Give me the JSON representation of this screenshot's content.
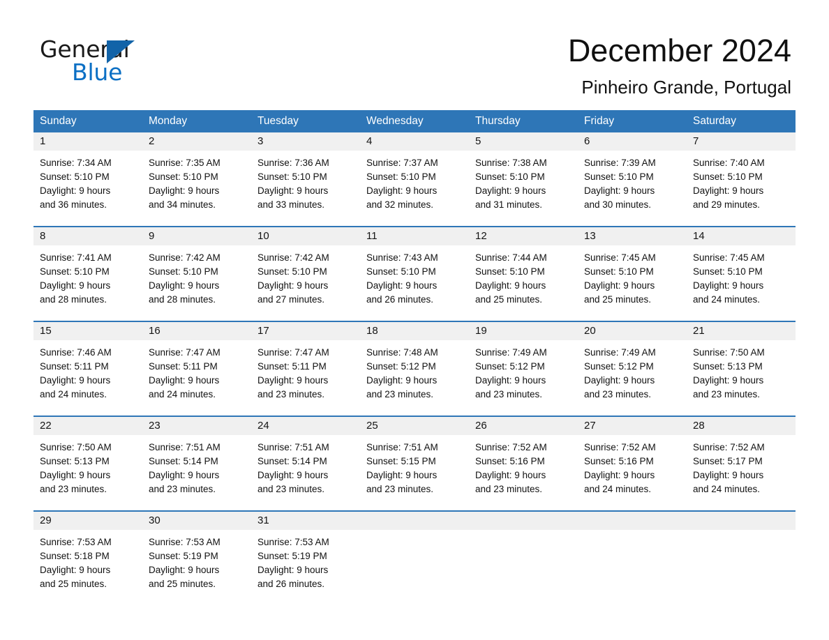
{
  "logo": {
    "word_one": "General",
    "word_two": "Blue",
    "accent_color": "#1263a8",
    "blue_text_color": "#0b6fc4"
  },
  "header": {
    "month_title": "December 2024",
    "location": "Pinheiro Grande, Portugal"
  },
  "theme": {
    "header_blue": "#2e76b7",
    "day_band_gray": "#f0f0f0",
    "text_black": "#111111"
  },
  "weekdays": [
    "Sunday",
    "Monday",
    "Tuesday",
    "Wednesday",
    "Thursday",
    "Friday",
    "Saturday"
  ],
  "weeks": [
    [
      {
        "day": "1",
        "sunrise": "Sunrise: 7:34 AM",
        "sunset": "Sunset: 5:10 PM",
        "daylight_line1": "Daylight: 9 hours",
        "daylight_line2": "and 36 minutes."
      },
      {
        "day": "2",
        "sunrise": "Sunrise: 7:35 AM",
        "sunset": "Sunset: 5:10 PM",
        "daylight_line1": "Daylight: 9 hours",
        "daylight_line2": "and 34 minutes."
      },
      {
        "day": "3",
        "sunrise": "Sunrise: 7:36 AM",
        "sunset": "Sunset: 5:10 PM",
        "daylight_line1": "Daylight: 9 hours",
        "daylight_line2": "and 33 minutes."
      },
      {
        "day": "4",
        "sunrise": "Sunrise: 7:37 AM",
        "sunset": "Sunset: 5:10 PM",
        "daylight_line1": "Daylight: 9 hours",
        "daylight_line2": "and 32 minutes."
      },
      {
        "day": "5",
        "sunrise": "Sunrise: 7:38 AM",
        "sunset": "Sunset: 5:10 PM",
        "daylight_line1": "Daylight: 9 hours",
        "daylight_line2": "and 31 minutes."
      },
      {
        "day": "6",
        "sunrise": "Sunrise: 7:39 AM",
        "sunset": "Sunset: 5:10 PM",
        "daylight_line1": "Daylight: 9 hours",
        "daylight_line2": "and 30 minutes."
      },
      {
        "day": "7",
        "sunrise": "Sunrise: 7:40 AM",
        "sunset": "Sunset: 5:10 PM",
        "daylight_line1": "Daylight: 9 hours",
        "daylight_line2": "and 29 minutes."
      }
    ],
    [
      {
        "day": "8",
        "sunrise": "Sunrise: 7:41 AM",
        "sunset": "Sunset: 5:10 PM",
        "daylight_line1": "Daylight: 9 hours",
        "daylight_line2": "and 28 minutes."
      },
      {
        "day": "9",
        "sunrise": "Sunrise: 7:42 AM",
        "sunset": "Sunset: 5:10 PM",
        "daylight_line1": "Daylight: 9 hours",
        "daylight_line2": "and 28 minutes."
      },
      {
        "day": "10",
        "sunrise": "Sunrise: 7:42 AM",
        "sunset": "Sunset: 5:10 PM",
        "daylight_line1": "Daylight: 9 hours",
        "daylight_line2": "and 27 minutes."
      },
      {
        "day": "11",
        "sunrise": "Sunrise: 7:43 AM",
        "sunset": "Sunset: 5:10 PM",
        "daylight_line1": "Daylight: 9 hours",
        "daylight_line2": "and 26 minutes."
      },
      {
        "day": "12",
        "sunrise": "Sunrise: 7:44 AM",
        "sunset": "Sunset: 5:10 PM",
        "daylight_line1": "Daylight: 9 hours",
        "daylight_line2": "and 25 minutes."
      },
      {
        "day": "13",
        "sunrise": "Sunrise: 7:45 AM",
        "sunset": "Sunset: 5:10 PM",
        "daylight_line1": "Daylight: 9 hours",
        "daylight_line2": "and 25 minutes."
      },
      {
        "day": "14",
        "sunrise": "Sunrise: 7:45 AM",
        "sunset": "Sunset: 5:10 PM",
        "daylight_line1": "Daylight: 9 hours",
        "daylight_line2": "and 24 minutes."
      }
    ],
    [
      {
        "day": "15",
        "sunrise": "Sunrise: 7:46 AM",
        "sunset": "Sunset: 5:11 PM",
        "daylight_line1": "Daylight: 9 hours",
        "daylight_line2": "and 24 minutes."
      },
      {
        "day": "16",
        "sunrise": "Sunrise: 7:47 AM",
        "sunset": "Sunset: 5:11 PM",
        "daylight_line1": "Daylight: 9 hours",
        "daylight_line2": "and 24 minutes."
      },
      {
        "day": "17",
        "sunrise": "Sunrise: 7:47 AM",
        "sunset": "Sunset: 5:11 PM",
        "daylight_line1": "Daylight: 9 hours",
        "daylight_line2": "and 23 minutes."
      },
      {
        "day": "18",
        "sunrise": "Sunrise: 7:48 AM",
        "sunset": "Sunset: 5:12 PM",
        "daylight_line1": "Daylight: 9 hours",
        "daylight_line2": "and 23 minutes."
      },
      {
        "day": "19",
        "sunrise": "Sunrise: 7:49 AM",
        "sunset": "Sunset: 5:12 PM",
        "daylight_line1": "Daylight: 9 hours",
        "daylight_line2": "and 23 minutes."
      },
      {
        "day": "20",
        "sunrise": "Sunrise: 7:49 AM",
        "sunset": "Sunset: 5:12 PM",
        "daylight_line1": "Daylight: 9 hours",
        "daylight_line2": "and 23 minutes."
      },
      {
        "day": "21",
        "sunrise": "Sunrise: 7:50 AM",
        "sunset": "Sunset: 5:13 PM",
        "daylight_line1": "Daylight: 9 hours",
        "daylight_line2": "and 23 minutes."
      }
    ],
    [
      {
        "day": "22",
        "sunrise": "Sunrise: 7:50 AM",
        "sunset": "Sunset: 5:13 PM",
        "daylight_line1": "Daylight: 9 hours",
        "daylight_line2": "and 23 minutes."
      },
      {
        "day": "23",
        "sunrise": "Sunrise: 7:51 AM",
        "sunset": "Sunset: 5:14 PM",
        "daylight_line1": "Daylight: 9 hours",
        "daylight_line2": "and 23 minutes."
      },
      {
        "day": "24",
        "sunrise": "Sunrise: 7:51 AM",
        "sunset": "Sunset: 5:14 PM",
        "daylight_line1": "Daylight: 9 hours",
        "daylight_line2": "and 23 minutes."
      },
      {
        "day": "25",
        "sunrise": "Sunrise: 7:51 AM",
        "sunset": "Sunset: 5:15 PM",
        "daylight_line1": "Daylight: 9 hours",
        "daylight_line2": "and 23 minutes."
      },
      {
        "day": "26",
        "sunrise": "Sunrise: 7:52 AM",
        "sunset": "Sunset: 5:16 PM",
        "daylight_line1": "Daylight: 9 hours",
        "daylight_line2": "and 23 minutes."
      },
      {
        "day": "27",
        "sunrise": "Sunrise: 7:52 AM",
        "sunset": "Sunset: 5:16 PM",
        "daylight_line1": "Daylight: 9 hours",
        "daylight_line2": "and 24 minutes."
      },
      {
        "day": "28",
        "sunrise": "Sunrise: 7:52 AM",
        "sunset": "Sunset: 5:17 PM",
        "daylight_line1": "Daylight: 9 hours",
        "daylight_line2": "and 24 minutes."
      }
    ],
    [
      {
        "day": "29",
        "sunrise": "Sunrise: 7:53 AM",
        "sunset": "Sunset: 5:18 PM",
        "daylight_line1": "Daylight: 9 hours",
        "daylight_line2": "and 25 minutes."
      },
      {
        "day": "30",
        "sunrise": "Sunrise: 7:53 AM",
        "sunset": "Sunset: 5:19 PM",
        "daylight_line1": "Daylight: 9 hours",
        "daylight_line2": "and 25 minutes."
      },
      {
        "day": "31",
        "sunrise": "Sunrise: 7:53 AM",
        "sunset": "Sunset: 5:19 PM",
        "daylight_line1": "Daylight: 9 hours",
        "daylight_line2": "and 26 minutes."
      },
      {
        "day": "",
        "sunrise": "",
        "sunset": "",
        "daylight_line1": "",
        "daylight_line2": ""
      },
      {
        "day": "",
        "sunrise": "",
        "sunset": "",
        "daylight_line1": "",
        "daylight_line2": ""
      },
      {
        "day": "",
        "sunrise": "",
        "sunset": "",
        "daylight_line1": "",
        "daylight_line2": ""
      },
      {
        "day": "",
        "sunrise": "",
        "sunset": "",
        "daylight_line1": "",
        "daylight_line2": ""
      }
    ]
  ]
}
